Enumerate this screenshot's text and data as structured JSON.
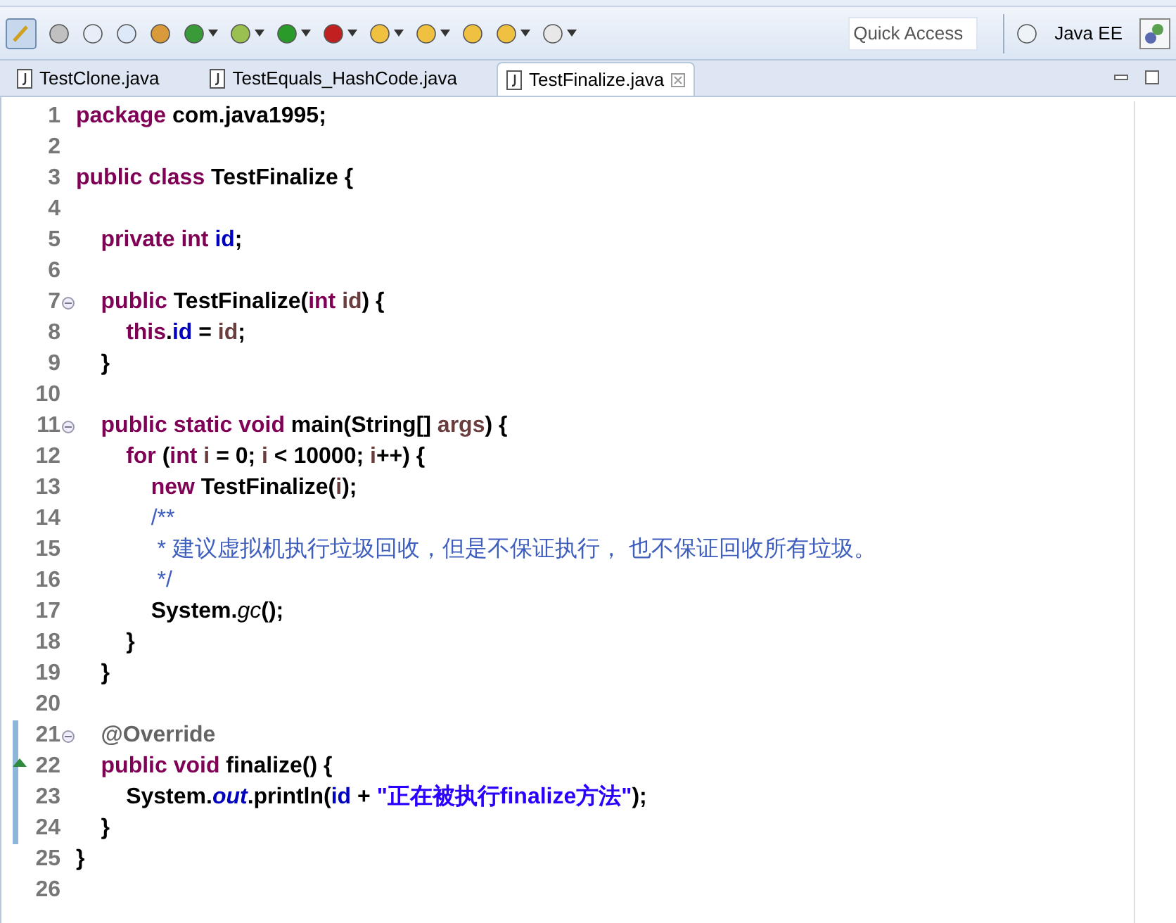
{
  "toolbar": {
    "quick_access": {
      "placeholder": "Quick Access"
    },
    "perspectives": [
      {
        "label": "Java EE",
        "selected": false
      }
    ]
  },
  "tabs": [
    {
      "label": "TestClone.java",
      "selected": false
    },
    {
      "label": "TestEquals_HashCode.java",
      "selected": false
    },
    {
      "label": "TestFinalize.java",
      "selected": true
    }
  ],
  "editor": {
    "lines": [
      {
        "number": "1",
        "tokens": [
          {
            "kind": "keyword",
            "text": "package "
          },
          {
            "kind": "plain",
            "text": "com.java1995;"
          }
        ]
      },
      {
        "number": "2"
      },
      {
        "number": "3",
        "tokens": [
          {
            "kind": "keyword",
            "text": "public class "
          },
          {
            "kind": "plain",
            "text": "TestFinalize {"
          }
        ]
      },
      {
        "number": "4"
      },
      {
        "number": "5",
        "tokens": [
          {
            "kind": "keyword",
            "text": "    private int "
          },
          {
            "kind": "field",
            "text": "id"
          },
          {
            "kind": "plain",
            "text": ";"
          }
        ]
      },
      {
        "number": "6"
      },
      {
        "number": "7",
        "fold": true,
        "tokens": [
          {
            "kind": "keyword",
            "text": "    public "
          },
          {
            "kind": "plain",
            "text": "TestFinalize("
          },
          {
            "kind": "keyword",
            "text": "int "
          },
          {
            "kind": "param",
            "text": "id"
          },
          {
            "kind": "plain",
            "text": ") {"
          }
        ]
      },
      {
        "number": "8",
        "tokens": [
          {
            "kind": "keyword",
            "text": "        this"
          },
          {
            "kind": "plain",
            "text": "."
          },
          {
            "kind": "field",
            "text": "id"
          },
          {
            "kind": "plain",
            "text": " = "
          },
          {
            "kind": "param",
            "text": "id"
          },
          {
            "kind": "plain",
            "text": ";"
          }
        ]
      },
      {
        "number": "9",
        "tokens": [
          {
            "kind": "plain",
            "text": "    }"
          }
        ]
      },
      {
        "number": "10"
      },
      {
        "number": "11",
        "fold": true,
        "tokens": [
          {
            "kind": "keyword",
            "text": "    public static void "
          },
          {
            "kind": "plain",
            "text": "main(String[] "
          },
          {
            "kind": "param",
            "text": "args"
          },
          {
            "kind": "plain",
            "text": ") {"
          }
        ]
      },
      {
        "number": "12",
        "tokens": [
          {
            "kind": "keyword",
            "text": "        for "
          },
          {
            "kind": "plain",
            "text": "("
          },
          {
            "kind": "keyword",
            "text": "int "
          },
          {
            "kind": "param",
            "text": "i"
          },
          {
            "kind": "plain",
            "text": " = 0; "
          },
          {
            "kind": "param",
            "text": "i"
          },
          {
            "kind": "plain",
            "text": " < 10000; "
          },
          {
            "kind": "param",
            "text": "i"
          },
          {
            "kind": "plain",
            "text": "++) {"
          }
        ]
      },
      {
        "number": "13",
        "tokens": [
          {
            "kind": "keyword",
            "text": "            new "
          },
          {
            "kind": "plain",
            "text": "TestFinalize("
          },
          {
            "kind": "param",
            "text": "i"
          },
          {
            "kind": "plain",
            "text": ");"
          }
        ]
      },
      {
        "number": "14",
        "tokens": [
          {
            "kind": "comment",
            "text": "            /**"
          }
        ]
      },
      {
        "number": "15",
        "tokens": [
          {
            "kind": "comment",
            "text": "             * 建议虚拟机执行垃圾回收，但是不保证执行， 也不保证回收所有垃圾。"
          }
        ]
      },
      {
        "number": "16",
        "tokens": [
          {
            "kind": "comment",
            "text": "             */"
          }
        ]
      },
      {
        "number": "17",
        "tokens": [
          {
            "kind": "plain",
            "text": "            System."
          },
          {
            "kind": "static_method",
            "text": "gc"
          },
          {
            "kind": "plain",
            "text": "();"
          }
        ]
      },
      {
        "number": "18",
        "tokens": [
          {
            "kind": "plain",
            "text": "        }"
          }
        ]
      },
      {
        "number": "19",
        "tokens": [
          {
            "kind": "plain",
            "text": "    }"
          }
        ]
      },
      {
        "number": "20"
      },
      {
        "number": "21",
        "fold": true,
        "changed": true,
        "tokens": [
          {
            "kind": "annotation",
            "text": "    @Override"
          }
        ]
      },
      {
        "number": "22",
        "override": true,
        "changed": true,
        "tokens": [
          {
            "kind": "keyword",
            "text": "    public void "
          },
          {
            "kind": "plain",
            "text": "finalize() {"
          }
        ]
      },
      {
        "number": "23",
        "changed": true,
        "tokens": [
          {
            "kind": "plain",
            "text": "        System."
          },
          {
            "kind": "static_field",
            "text": "out"
          },
          {
            "kind": "plain",
            "text": ".println("
          },
          {
            "kind": "field",
            "text": "id"
          },
          {
            "kind": "plain",
            "text": " + "
          },
          {
            "kind": "string",
            "text": "\"正在被执行finalize方法\""
          },
          {
            "kind": "plain",
            "text": ");"
          }
        ]
      },
      {
        "number": "24",
        "changed": true,
        "tokens": [
          {
            "kind": "plain",
            "text": "    }"
          }
        ]
      },
      {
        "number": "25",
        "tokens": [
          {
            "kind": "plain",
            "text": "}"
          }
        ]
      },
      {
        "number": "26"
      }
    ]
  }
}
